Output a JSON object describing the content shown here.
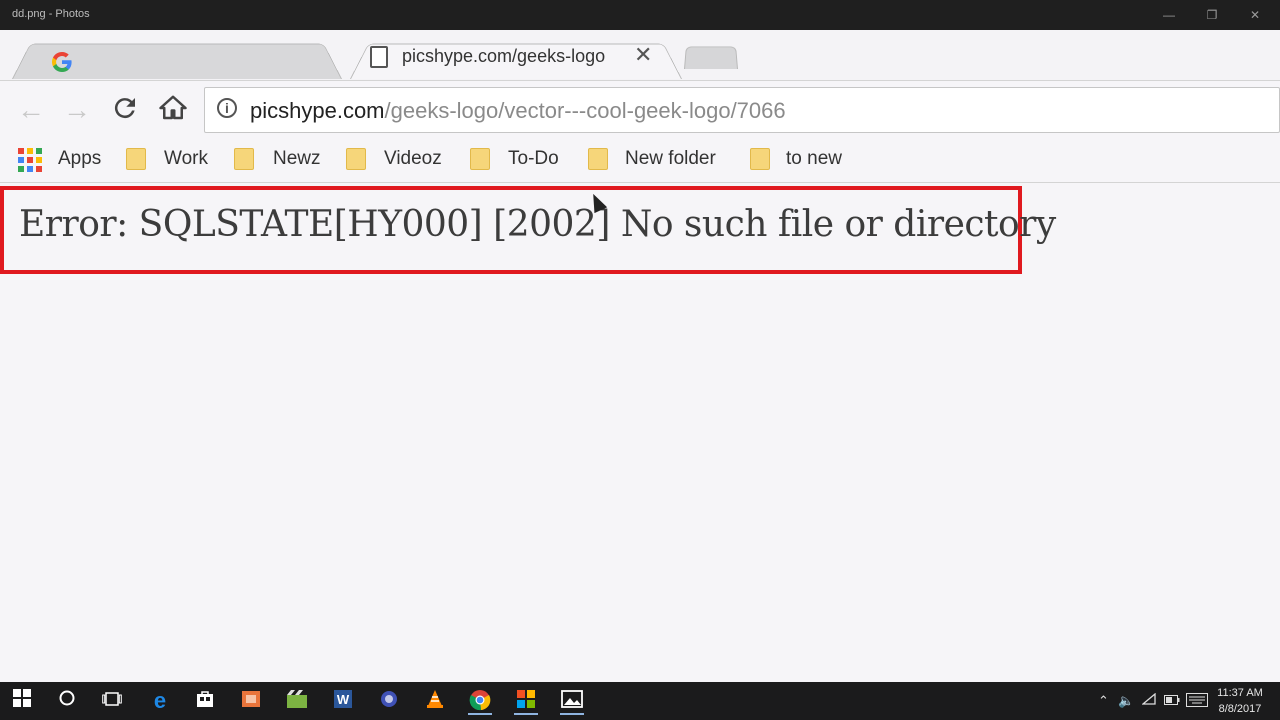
{
  "window": {
    "title": "dd.png - Photos"
  },
  "browser": {
    "tabs": [
      {
        "label": "",
        "icon": "google-g-icon",
        "active": false
      },
      {
        "label": "picshype.com/geeks-logo",
        "icon": "file-icon",
        "active": true
      }
    ],
    "address": {
      "host": "picshype.com",
      "path": "/geeks-logo/vector---cool-geek-logo/7066"
    },
    "bookmarks": [
      {
        "label": "Apps",
        "icon": "apps-grid-icon"
      },
      {
        "label": "Work",
        "icon": "folder-icon"
      },
      {
        "label": "Newz",
        "icon": "folder-icon"
      },
      {
        "label": "Videoz",
        "icon": "folder-icon"
      },
      {
        "label": "To-Do",
        "icon": "folder-icon"
      },
      {
        "label": "New folder",
        "icon": "folder-icon"
      },
      {
        "label": "to new",
        "icon": "folder-icon"
      }
    ]
  },
  "page": {
    "error_message": "Error: SQLSTATE[HY000] [2002] No such file or directory",
    "highlight_color": "#e0191f"
  },
  "taskbar": {
    "clock_time": "11:37 AM",
    "clock_date": "8/8/2017"
  }
}
